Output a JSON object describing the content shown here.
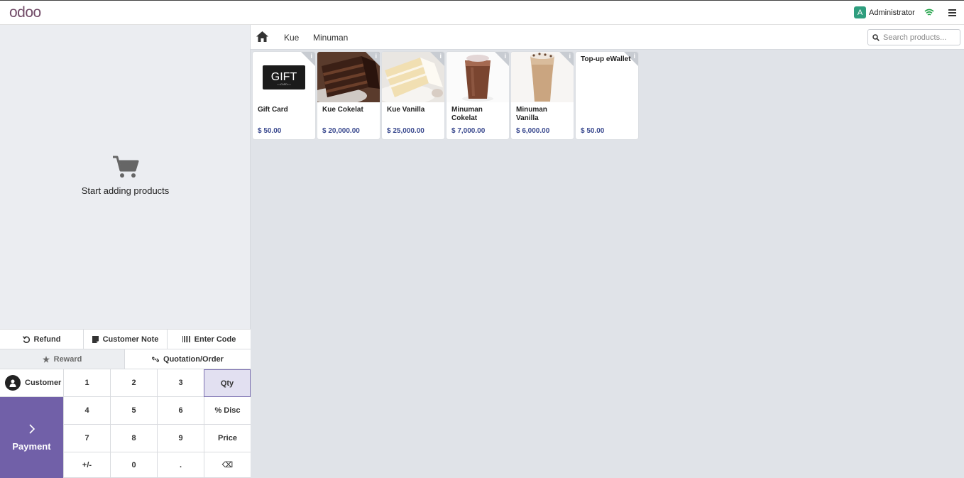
{
  "header": {
    "logo_text": "odoo",
    "user_initial": "A",
    "user_name": "Administrator"
  },
  "cart": {
    "empty_message": "Start adding products"
  },
  "controls": {
    "refund": "Refund",
    "customer_note": "Customer Note",
    "enter_code": "Enter Code",
    "reward": "Reward",
    "quotation": "Quotation/Order"
  },
  "customer_label": "Customer",
  "payment_label": "Payment",
  "numpad": {
    "k1": "1",
    "k2": "2",
    "k3": "3",
    "qty": "Qty",
    "k4": "4",
    "k5": "5",
    "k6": "6",
    "disc": "% Disc",
    "k7": "7",
    "k8": "8",
    "k9": "9",
    "price": "Price",
    "sign": "+/-",
    "k0": "0",
    "dot": ".",
    "back": "⌫"
  },
  "categories": [
    "Kue",
    "Minuman"
  ],
  "search": {
    "placeholder": "Search products..."
  },
  "products": [
    {
      "name": "Gift Card",
      "price": "$ 50.00",
      "image_text": "GIFT",
      "image_subtext": "CARD"
    },
    {
      "name": "Kue Cokelat",
      "price": "$ 20,000.00"
    },
    {
      "name": "Kue Vanilla",
      "price": "$ 25,000.00"
    },
    {
      "name": "Minuman Cokelat",
      "price": "$ 7,000.00"
    },
    {
      "name": "Minuman Vanilla",
      "price": "$ 6,000.00"
    },
    {
      "name": "Top-up eWallet",
      "price": "$ 50.00"
    }
  ],
  "info_glyph": "i",
  "colors": {
    "accent": "#7160a8",
    "price": "#3b4a8f",
    "avatar": "#2f9e7e"
  }
}
